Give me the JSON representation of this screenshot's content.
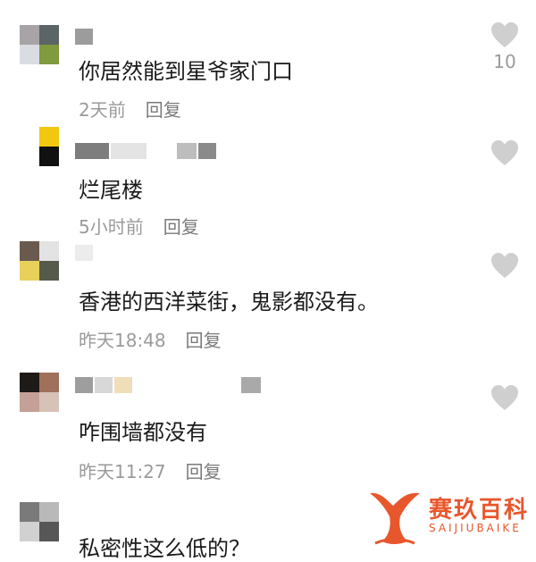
{
  "comments": [
    {
      "text": "你居然能到星爷家门口",
      "time": "2天前",
      "reply": "回复",
      "likes": "10"
    },
    {
      "text": "烂尾楼",
      "time": "5小时前",
      "reply": "回复",
      "likes": ""
    },
    {
      "text": "香港的西洋菜街，鬼影都没有。",
      "time": "昨天18:48",
      "reply": "回复",
      "likes": ""
    },
    {
      "text": "咋围墙都没有",
      "time": "昨天11:27",
      "reply": "回复",
      "likes": ""
    },
    {
      "text": "私密性这么低的？",
      "time": "",
      "reply": "",
      "likes": ""
    }
  ],
  "watermark": {
    "name": "赛玖百科",
    "latin": "SAIJIUBAIKE"
  },
  "colors": {
    "heart": "#cfcfcf",
    "text": "#1a1a1a",
    "meta": "#9a9a9a",
    "brand": "#e8572c"
  }
}
